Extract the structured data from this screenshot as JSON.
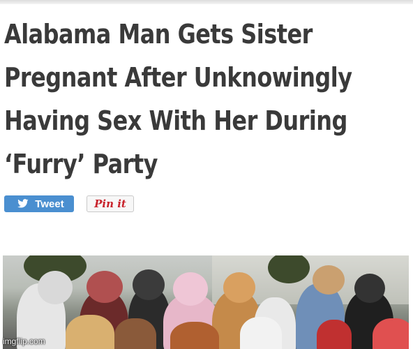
{
  "article": {
    "headline_lines": [
      "Alabama Man Gets Sister",
      "Pregnant After Unknowingly",
      "Having Sex With Her During",
      "‘Furry’ Party"
    ]
  },
  "share": {
    "tweet_label": "Tweet",
    "pin_label": "Pin it"
  },
  "photo": {
    "description_icon": "photo-of-costumed-crowd"
  },
  "watermark": "imgflip.com",
  "colors": {
    "headline": "#3a3a3a",
    "tweet_button": "#4a8fd0",
    "pin_text": "#c8232c"
  }
}
